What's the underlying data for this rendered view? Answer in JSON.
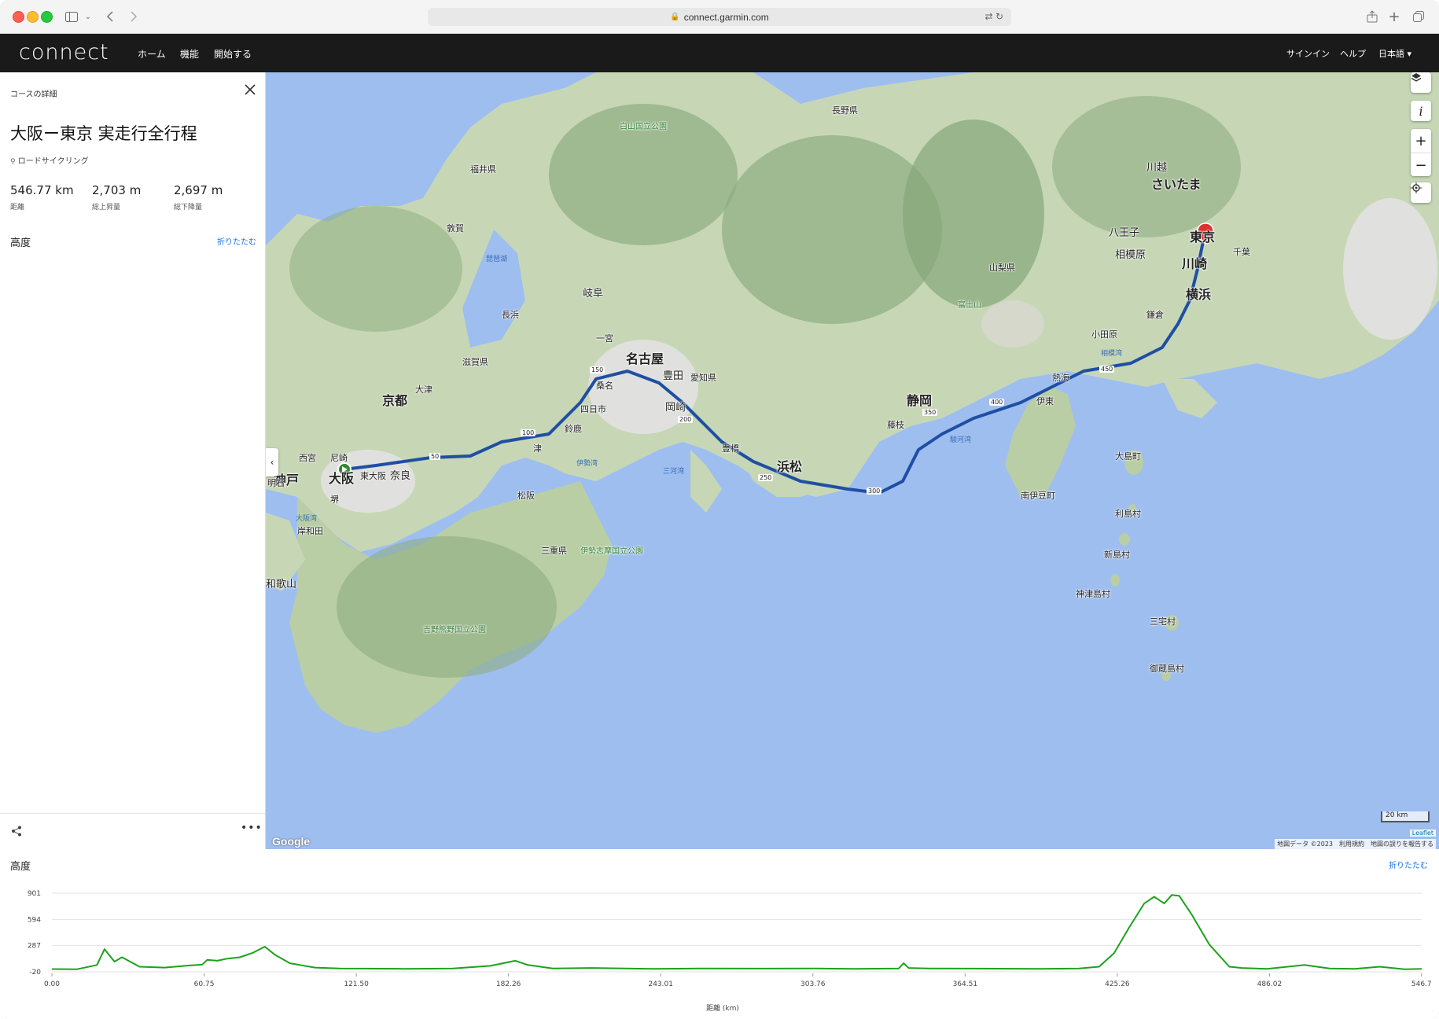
{
  "browser": {
    "url": "connect.garmin.com",
    "icons": [
      "sidebar-icon",
      "chevron-down-icon",
      "back-icon",
      "forward-icon",
      "lock-icon",
      "translate-icon",
      "reload-icon",
      "share-icon",
      "new-tab-icon",
      "tabs-icon"
    ]
  },
  "nav": {
    "logo": "connect",
    "links": [
      "ホーム",
      "機能",
      "開始する"
    ],
    "right": [
      "サインイン",
      "ヘルプ",
      "日本語 ▾"
    ]
  },
  "panel": {
    "header": "コースの詳細",
    "title": "大阪ー東京 実走行全行程",
    "activity": "ロードサイクリング",
    "stats": [
      {
        "value": "546.77 km",
        "label": "距離"
      },
      {
        "value": "2,703 m",
        "label": "総上昇量"
      },
      {
        "value": "2,697 m",
        "label": "総下降量"
      }
    ],
    "elevation_title": "高度",
    "collapse": "折りたたむ"
  },
  "map": {
    "labels": {
      "nagoya": "名古屋",
      "kyoto": "京都",
      "osaka": "大阪",
      "kobe": "神戸",
      "hamamatsu": "浜松",
      "shizuoka": "静岡",
      "tokyo": "東京",
      "yokohama": "横浜",
      "kawasaki": "川崎",
      "saitama": "さいたま",
      "gifu": "岐阜",
      "nara": "奈良",
      "toyota": "豊田",
      "okazaki": "岡崎",
      "fuji": "富士山",
      "wakayama": "和歌山",
      "hachioji": "八王子",
      "sagamihara": "相模原",
      "kawagoe": "川越",
      "fukui": "福井県",
      "shiga": "滋賀県",
      "mie": "三重県",
      "aichi": "愛知県",
      "nagano": "長野県",
      "yamanashi": "山梨県",
      "ise_bay": "伊勢湾",
      "mikawa_bay": "三河湾",
      "suruga_bay": "駿河湾",
      "sagami_bay": "相模湾",
      "osaka_bay": "大阪湾",
      "izu": "伊東",
      "shimoda": "南伊豆町",
      "oshima": "大島町",
      "toshima": "利島村",
      "niijima": "新島村",
      "kozushima": "神津島村",
      "miyake": "三宅村",
      "mikura": "御蔵島村",
      "biwa": "琵琶湖",
      "ise_shima": "伊勢志摩国立公園",
      "yoshino": "吉野熊野国立公園",
      "hakusan": "白山国立公園",
      "tsu": "津",
      "nagahama": "長浜",
      "toyohashi": "豊橋",
      "ichinomiya": "一宮",
      "otsu": "大津",
      "kuwana": "桑名",
      "yokkaichi": "四日市",
      "suzuka": "鈴鹿",
      "tsuruga": "敦賀",
      "fujieda": "藤枝",
      "atami": "熱海",
      "odawara": "小田原",
      "kamakura": "鎌倉",
      "chiba": "千葉",
      "matsusaka": "松阪",
      "nishinomiya": "西宮",
      "amagasaki": "尼崎",
      "sakai": "堺",
      "higashiosaka": "東大阪",
      "kishiwada": "岸和田",
      "akashi": "明石"
    },
    "route_km_markers": [
      "50",
      "100",
      "150",
      "200",
      "250",
      "300",
      "350",
      "400",
      "450"
    ],
    "scale": "20 km",
    "leaflet": "Leaflet",
    "attribution": "地図データ ©2023　利用規約　地図の誤りを報告する",
    "google": "Google",
    "controls": [
      "layers-icon",
      "info-icon",
      "zoom-in-icon",
      "zoom-out-icon",
      "locate-icon"
    ]
  },
  "elevation": {
    "title": "高度",
    "collapse": "折りたたむ",
    "xlabel": "距離 (km)"
  },
  "chart_data": {
    "type": "area",
    "title": "",
    "xlabel": "距離 (km)",
    "ylabel": "",
    "xlim": [
      0,
      546.77
    ],
    "ylim": [
      -20,
      901
    ],
    "yticks": [
      "901",
      "594",
      "287",
      "-20"
    ],
    "xticks": [
      "0.00",
      "60.75",
      "121.50",
      "182.26",
      "243.01",
      "303.76",
      "364.51",
      "425.26",
      "486.02",
      "546.7"
    ],
    "series": [
      {
        "color": "#1aa31a",
        "x": [
          0,
          10,
          18,
          21,
          25,
          28,
          35,
          45,
          55,
          60,
          62,
          66,
          70,
          75,
          80,
          85,
          89,
          95,
          105,
          115,
          125,
          140,
          160,
          175,
          185,
          190,
          200,
          215,
          240,
          260,
          285,
          305,
          320,
          338,
          340,
          342,
          350,
          370,
          395,
          410,
          418,
          424,
          430,
          436,
          440,
          444,
          447,
          450,
          455,
          462,
          470,
          475,
          485,
          500,
          510,
          520,
          530,
          540,
          546.77
        ],
        "y": [
          12,
          10,
          60,
          245,
          100,
          150,
          40,
          30,
          55,
          65,
          120,
          110,
          135,
          150,
          200,
          275,
          180,
          80,
          30,
          20,
          18,
          15,
          20,
          50,
          110,
          60,
          20,
          25,
          15,
          20,
          18,
          20,
          15,
          20,
          80,
          25,
          20,
          18,
          15,
          20,
          40,
          200,
          500,
          780,
          860,
          780,
          880,
          870,
          650,
          300,
          40,
          25,
          15,
          60,
          20,
          15,
          40,
          10,
          15
        ]
      }
    ]
  }
}
